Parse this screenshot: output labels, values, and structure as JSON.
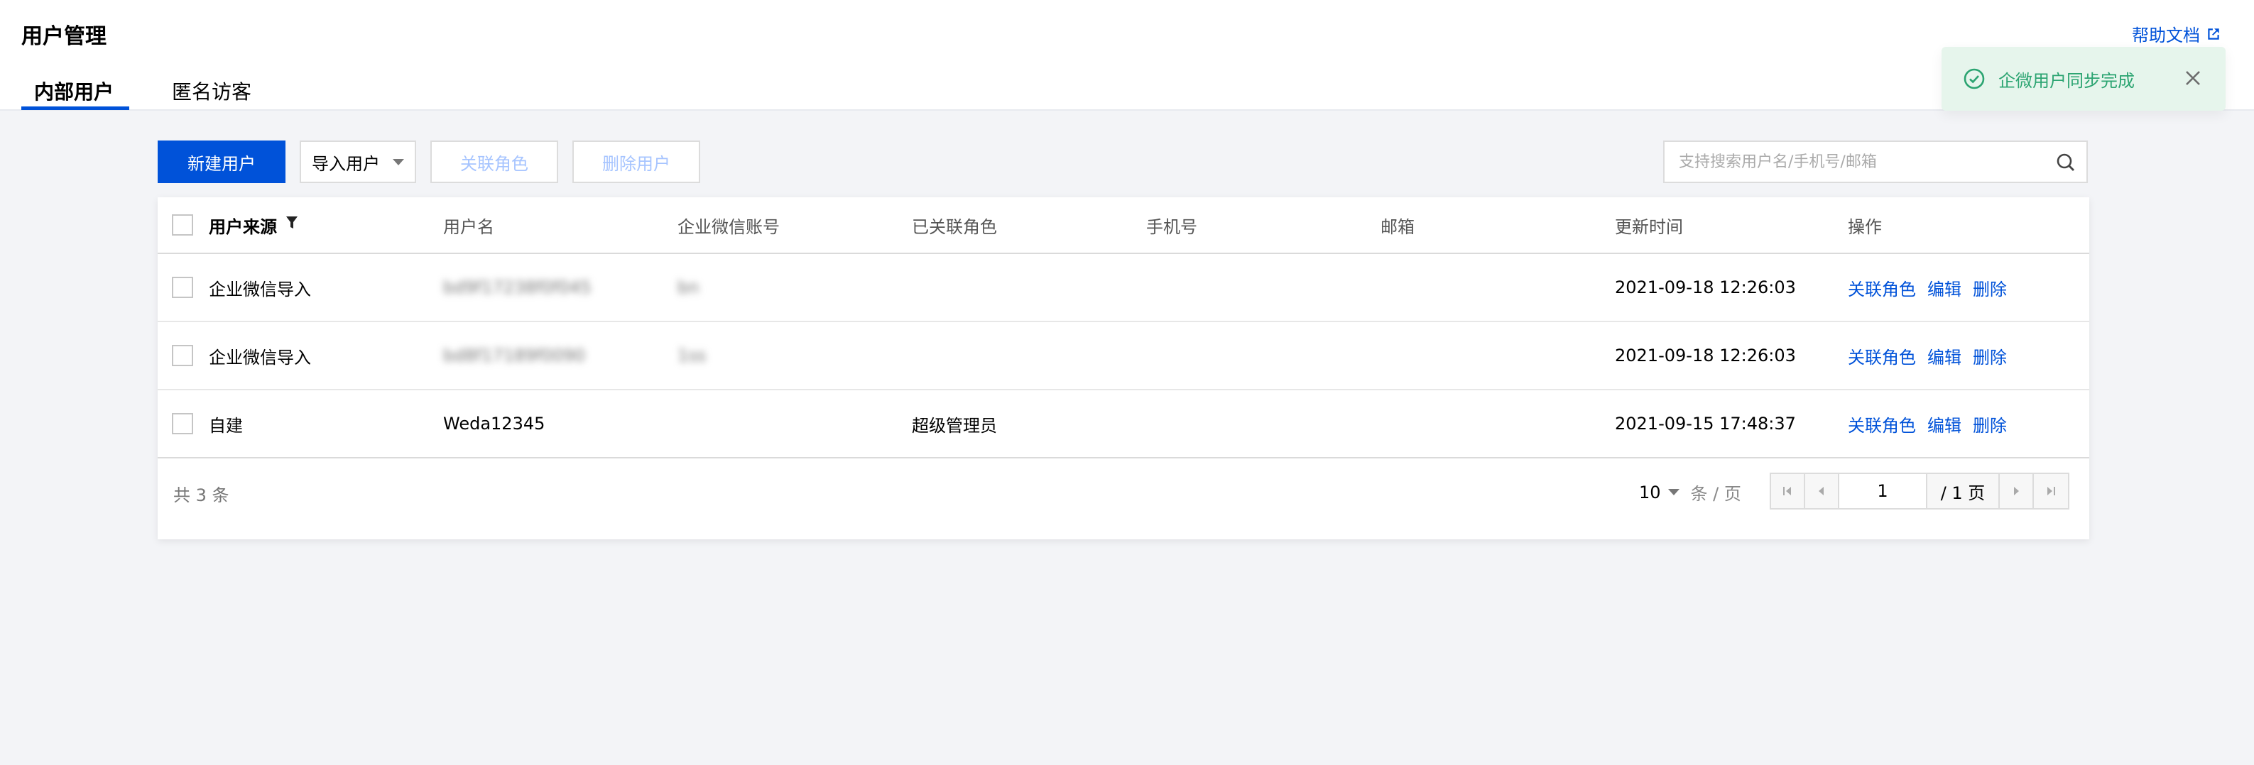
{
  "header": {
    "title": "用户管理",
    "help_label": "帮助文档",
    "tabs": [
      {
        "label": "内部用户",
        "active": true
      },
      {
        "label": "匿名访客",
        "active": false
      }
    ]
  },
  "toast": {
    "message": "企微用户同步完成",
    "status_color": "#2ba471"
  },
  "toolbar": {
    "new_user": "新建用户",
    "import_user": "导入用户",
    "link_role": "关联角色",
    "delete_user": "删除用户",
    "search_placeholder": "支持搜索用户名/手机号/邮箱"
  },
  "table": {
    "columns": [
      "用户来源",
      "用户名",
      "企业微信账号",
      "已关联角色",
      "手机号",
      "邮箱",
      "更新时间",
      "操作"
    ],
    "rows": [
      {
        "source": "企业微信导入",
        "username": "bd9f17238f0f045",
        "wework": "bn",
        "role": "",
        "phone": "",
        "email": "",
        "updated": "2021-09-18 12:26:03"
      },
      {
        "source": "企业微信导入",
        "username": "bd8f17189f0090",
        "wework": "1ss",
        "role": "",
        "phone": "",
        "email": "",
        "updated": "2021-09-18 12:26:03"
      },
      {
        "source": "自建",
        "username": "Weda12345",
        "wework": "",
        "role": "超级管理员",
        "phone": "",
        "email": "",
        "updated": "2021-09-15 17:48:37"
      }
    ],
    "actions": [
      "关联角色",
      "编辑",
      "删除"
    ]
  },
  "footer": {
    "total": "共 3 条",
    "page_size": "10",
    "page_size_unit": "条 / 页",
    "current_page": "1",
    "total_pages": "/ 1 页"
  },
  "colors": {
    "primary": "#0052d9",
    "background": "#f3f4f7"
  }
}
